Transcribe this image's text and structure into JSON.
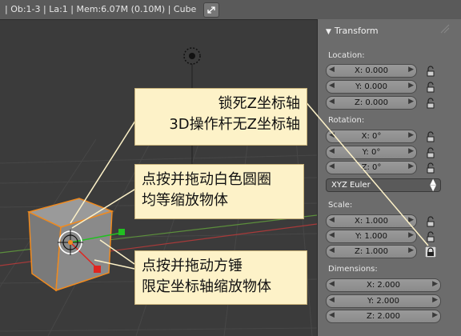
{
  "header": {
    "info": "| Ob:1-3 | La:1 | Mem:6.07M (0.10M) | Cube",
    "fullscreen_icon": "fullscreen-icon"
  },
  "panel": {
    "title": "Transform",
    "location": {
      "label": "Location:",
      "x": "X: 0.000",
      "y": "Y: 0.000",
      "z": "Z: 0.000"
    },
    "rotation": {
      "label": "Rotation:",
      "x": "X: 0°",
      "y": "Y: 0°",
      "z": "Z: 0°",
      "mode": "XYZ Euler"
    },
    "scale": {
      "label": "Scale:",
      "x": "X: 1.000",
      "y": "Y: 1.000",
      "z": "Z: 1.000"
    },
    "dimensions": {
      "label": "Dimensions:",
      "x": "X: 2.000",
      "y": "Y: 2.000",
      "z": "Z: 2.000"
    },
    "scale_z_locked": true
  },
  "callouts": {
    "lock_z": {
      "line1": "锁死Z坐标轴",
      "line2": "3D操作杆无Z坐标轴"
    },
    "uniform": {
      "line1": "点按并拖动白色圆圈",
      "line2": "均等缩放物体"
    },
    "axis": {
      "line1": "点按并拖动方锤",
      "line2": "限定坐标轴缩放物体"
    }
  },
  "colors": {
    "callout_bg": "#fdf2c8",
    "panel_bg": "#6c6c6c",
    "viewport_bg": "#3b3b3b",
    "x_axis": "#e0251f",
    "y_axis": "#21c021",
    "selection": "#f08a1e"
  }
}
